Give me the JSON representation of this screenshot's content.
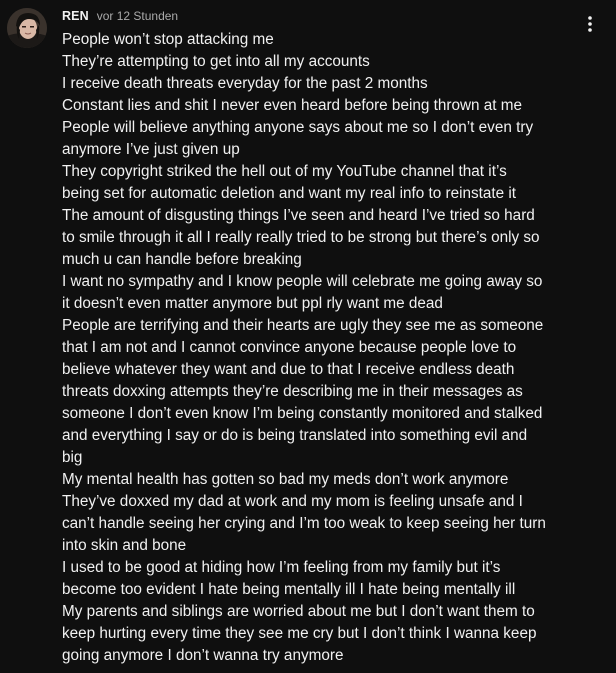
{
  "comment": {
    "author": "REN",
    "timestamp": "vor 12 Stunden",
    "avatar_icon": "avatar-photo",
    "menu_icon": "more-vert-icon",
    "lines": [
      "People won’t stop attacking me",
      "They’re attempting to get into all my accounts",
      "I receive death threats everyday for the past 2 months",
      "Constant lies and shit I never even heard before being thrown at me",
      "People will believe anything anyone says about me so I don’t even try",
      "anymore I’ve just given up",
      "They copyright striked the hell out of my YouTube channel that it’s",
      "being set for automatic deletion and want my real info to reinstate it",
      "The amount of disgusting things I’ve seen and heard I’ve tried so hard",
      "to smile through it all I really really tried to be strong but there’s only so",
      "much u can handle before breaking",
      "I want no sympathy and I know people will celebrate me going away so",
      "it doesn’t even matter anymore but ppl rly want me dead",
      "People are terrifying and their hearts are ugly they see me as someone",
      "that I am not and I cannot convince anyone because people love to",
      "believe whatever they want and due to that I receive endless death",
      "threats doxxing attempts they’re describing me in their messages as",
      "someone I don’t even know I’m being constantly monitored and stalked",
      "and everything I say or do is being translated into something evil and",
      "big",
      "My mental health has gotten so bad my meds don’t work anymore",
      "They’ve doxxed my dad at work and my mom is feeling unsafe and I",
      "can’t handle seeing her crying and I’m too weak to keep seeing her turn",
      "into skin and bone",
      "I used to be good at hiding how I’m feeling from my family but it’s",
      "become too evident I hate being mentally ill I hate being mentally ill",
      "My parents and siblings are worried about me but I don’t want them to",
      "keep hurting every time they see me cry but I don’t think I wanna keep",
      "going anymore I don’t wanna try anymore"
    ]
  }
}
